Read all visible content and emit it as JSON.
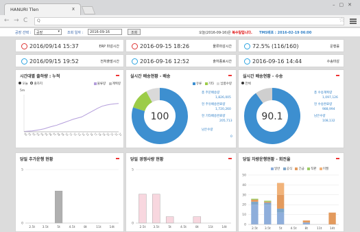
{
  "browser": {
    "tab_title": "HANURI Tlen",
    "tab_close": "x",
    "address": "Q"
  },
  "filter": {
    "project_label": "공장 선택 :",
    "project_value": "공장",
    "date_label": "조회 일자 :",
    "date_value": "2016-09-16",
    "search_btn": "조회",
    "notice_text": "오늘(2016-09-16)은 ",
    "notice_highlight": "복수일입니다.",
    "tms_text": "TMS배포 : 2016-02-19 06:00"
  },
  "kpis": [
    {
      "value": "2016/09/14 15:37",
      "label": "ERP 마감시간",
      "icon": "clock-red"
    },
    {
      "value": "2016-09-15 18:26",
      "label": "물류마감시간",
      "icon": "clock-red"
    },
    {
      "value": "72.5% (116/160)",
      "label": "운행률",
      "icon": "clock-blue"
    },
    {
      "value": "2016/09/15 19:52",
      "label": "전처출발시간",
      "icon": "clock-blue"
    },
    {
      "value": "2016-09-16 12:52",
      "label": "출하종료시간",
      "icon": "clock-blue"
    },
    {
      "value": "2016-09-16 14:44",
      "label": "수송마감",
      "icon": "clock-blue"
    }
  ],
  "panels": {
    "p1": {
      "title": "시간대별 출하량 : 누적",
      "radio1": "오늘",
      "radio2": "출하지",
      "legend1": "물류량",
      "legend2": "계획량",
      "ymax": "5m"
    },
    "p2": {
      "title": "실시간 배송현황 - 배송",
      "legend": [
        "유류",
        "기타",
        "납품수량"
      ],
      "center": "100",
      "items": [
        {
          "label": "총 주문배송량",
          "value": "1,826,005"
        },
        {
          "label": "현 주유배송완료량",
          "value": "1,720,260"
        },
        {
          "label": "현 기타배송완료량",
          "value": "205,713"
        },
        {
          "label": "남은수량",
          "value": "0"
        }
      ]
    },
    "p3": {
      "title": "실시간 배송현황 - 수송",
      "radio": "전체",
      "center": "90.1",
      "items": [
        {
          "label": "총 수송계획량",
          "value": "1,097,126"
        },
        {
          "label": "현 수송완료량",
          "value": "988,994"
        },
        {
          "label": "남은수량",
          "value": "108,132"
        }
      ]
    },
    "p4": {
      "title": "당일 추가운행 현황"
    },
    "p5": {
      "title": "당일 경쟁사량 현황"
    },
    "p6": {
      "title": "당일 차량운행현황 - 회전율",
      "legend": [
        "일반",
        "공식",
        "긴급",
        "직판",
        "이월"
      ]
    }
  },
  "chart_data": [
    {
      "type": "line",
      "title": "시간대별 출하량 : 누적",
      "x": [
        "00",
        "01",
        "02",
        "03",
        "04",
        "05",
        "06",
        "07",
        "08",
        "09",
        "10",
        "11",
        "12",
        "13",
        "14",
        "15",
        "16",
        "17",
        "18",
        "19",
        "20",
        "21",
        "22",
        "23"
      ],
      "series": [
        {
          "name": "물류량",
          "values": [
            0.05,
            0.08,
            0.12,
            0.2,
            0.3,
            0.42,
            0.6,
            0.75,
            0.9,
            1.1,
            1.3,
            1.5,
            1.7,
            1.85,
            2.0,
            2.3,
            2.6,
            2.9,
            3.2,
            3.45,
            3.6,
            3.7,
            3.78,
            3.82
          ],
          "color": "#b39ddb"
        },
        {
          "name": "계획량",
          "values": [
            0,
            0,
            0,
            0,
            0,
            0,
            0,
            0,
            0,
            0,
            0,
            0,
            0,
            0,
            0,
            0,
            0,
            0,
            0,
            0,
            0,
            0,
            0,
            0
          ],
          "color": "#bdbdbd"
        }
      ],
      "ylim": [
        0,
        5
      ]
    },
    {
      "type": "pie",
      "title": "실시간 배송현황 - 배송",
      "labels": [
        "유류",
        "기타",
        "납품수량"
      ],
      "values": [
        80,
        12,
        8
      ],
      "colors": [
        "#3d8fd0",
        "#9ccc48",
        "#d9d9d9"
      ]
    },
    {
      "type": "pie",
      "title": "실시간 배송현황 - 수송",
      "labels": [
        "완료",
        "남은수량"
      ],
      "values": [
        90.1,
        9.9
      ],
      "colors": [
        "#3d8fd0",
        "#cfcfcf"
      ]
    },
    {
      "type": "bar",
      "title": "당일 추가운행 현황",
      "categories": [
        "2.5t",
        "3.5t",
        "5t",
        "4.5t",
        "8t",
        "11t",
        "14t"
      ],
      "values": [
        0,
        0,
        3,
        0,
        0,
        0,
        0
      ],
      "ylim": [
        0,
        5
      ],
      "color": "#b0b0b0",
      "yticks": [
        0,
        5
      ]
    },
    {
      "type": "bar",
      "title": "당일 경쟁사량 현황",
      "categories": [
        "2.5t",
        "3.5t",
        "5t",
        "4.5t",
        "8t",
        "11t",
        "14t"
      ],
      "values": [
        2.7,
        2.7,
        0.6,
        0,
        0.6,
        0,
        0
      ],
      "ylim": [
        0,
        5
      ],
      "color": "#f8d7df",
      "yticks": [
        0,
        5
      ]
    },
    {
      "type": "bar",
      "title": "당일 차량운행현황 - 회전율",
      "categories": [
        "2.5t",
        "3.5t",
        "5t",
        "4.5t",
        "8t",
        "11t",
        "14t"
      ],
      "stacked": true,
      "series": [
        {
          "name": "일반",
          "values": [
            20,
            20,
            12,
            0,
            2,
            0,
            0
          ],
          "color": "#8eaedb"
        },
        {
          "name": "공식",
          "values": [
            3,
            2,
            4,
            0,
            0,
            0,
            0
          ],
          "color": "#7fa6c9"
        },
        {
          "name": "긴급",
          "values": [
            2,
            1,
            14,
            0,
            2,
            0,
            12
          ],
          "color": "#e39a5d"
        },
        {
          "name": "직판",
          "values": [
            1,
            1,
            0,
            0,
            0,
            0,
            0
          ],
          "color": "#9ccc65"
        },
        {
          "name": "이월",
          "values": [
            0,
            0,
            12,
            0,
            0,
            0,
            0
          ],
          "color": "#f1b37a"
        }
      ],
      "ylim": [
        0,
        50
      ],
      "yticks": [
        0,
        10,
        20,
        30,
        40,
        50
      ]
    }
  ]
}
